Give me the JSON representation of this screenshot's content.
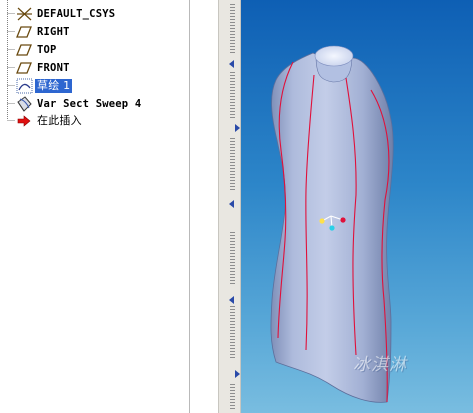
{
  "model_tree": {
    "items": [
      {
        "label": "DEFAULT_CSYS",
        "icon": "csys-icon"
      },
      {
        "label": "RIGHT",
        "icon": "datum-plane-icon"
      },
      {
        "label": "TOP",
        "icon": "datum-plane-icon"
      },
      {
        "label": "FRONT",
        "icon": "datum-plane-icon"
      },
      {
        "label": "草绘 1",
        "icon": "sketch-icon",
        "selected": true
      },
      {
        "label": "Var Sect Sweep 4",
        "icon": "sweep-feature-icon"
      },
      {
        "label": "在此插入",
        "icon": "insert-here-arrow-icon"
      }
    ]
  },
  "viewport": {
    "watermark": "冰淇淋",
    "model": "dress-form-surface",
    "colors": {
      "background_top": "#0e5fb4",
      "background_bottom": "#79bde0",
      "surface": "#aab8d8",
      "curves": "#e0103a",
      "selection": "#2d66d0"
    }
  }
}
